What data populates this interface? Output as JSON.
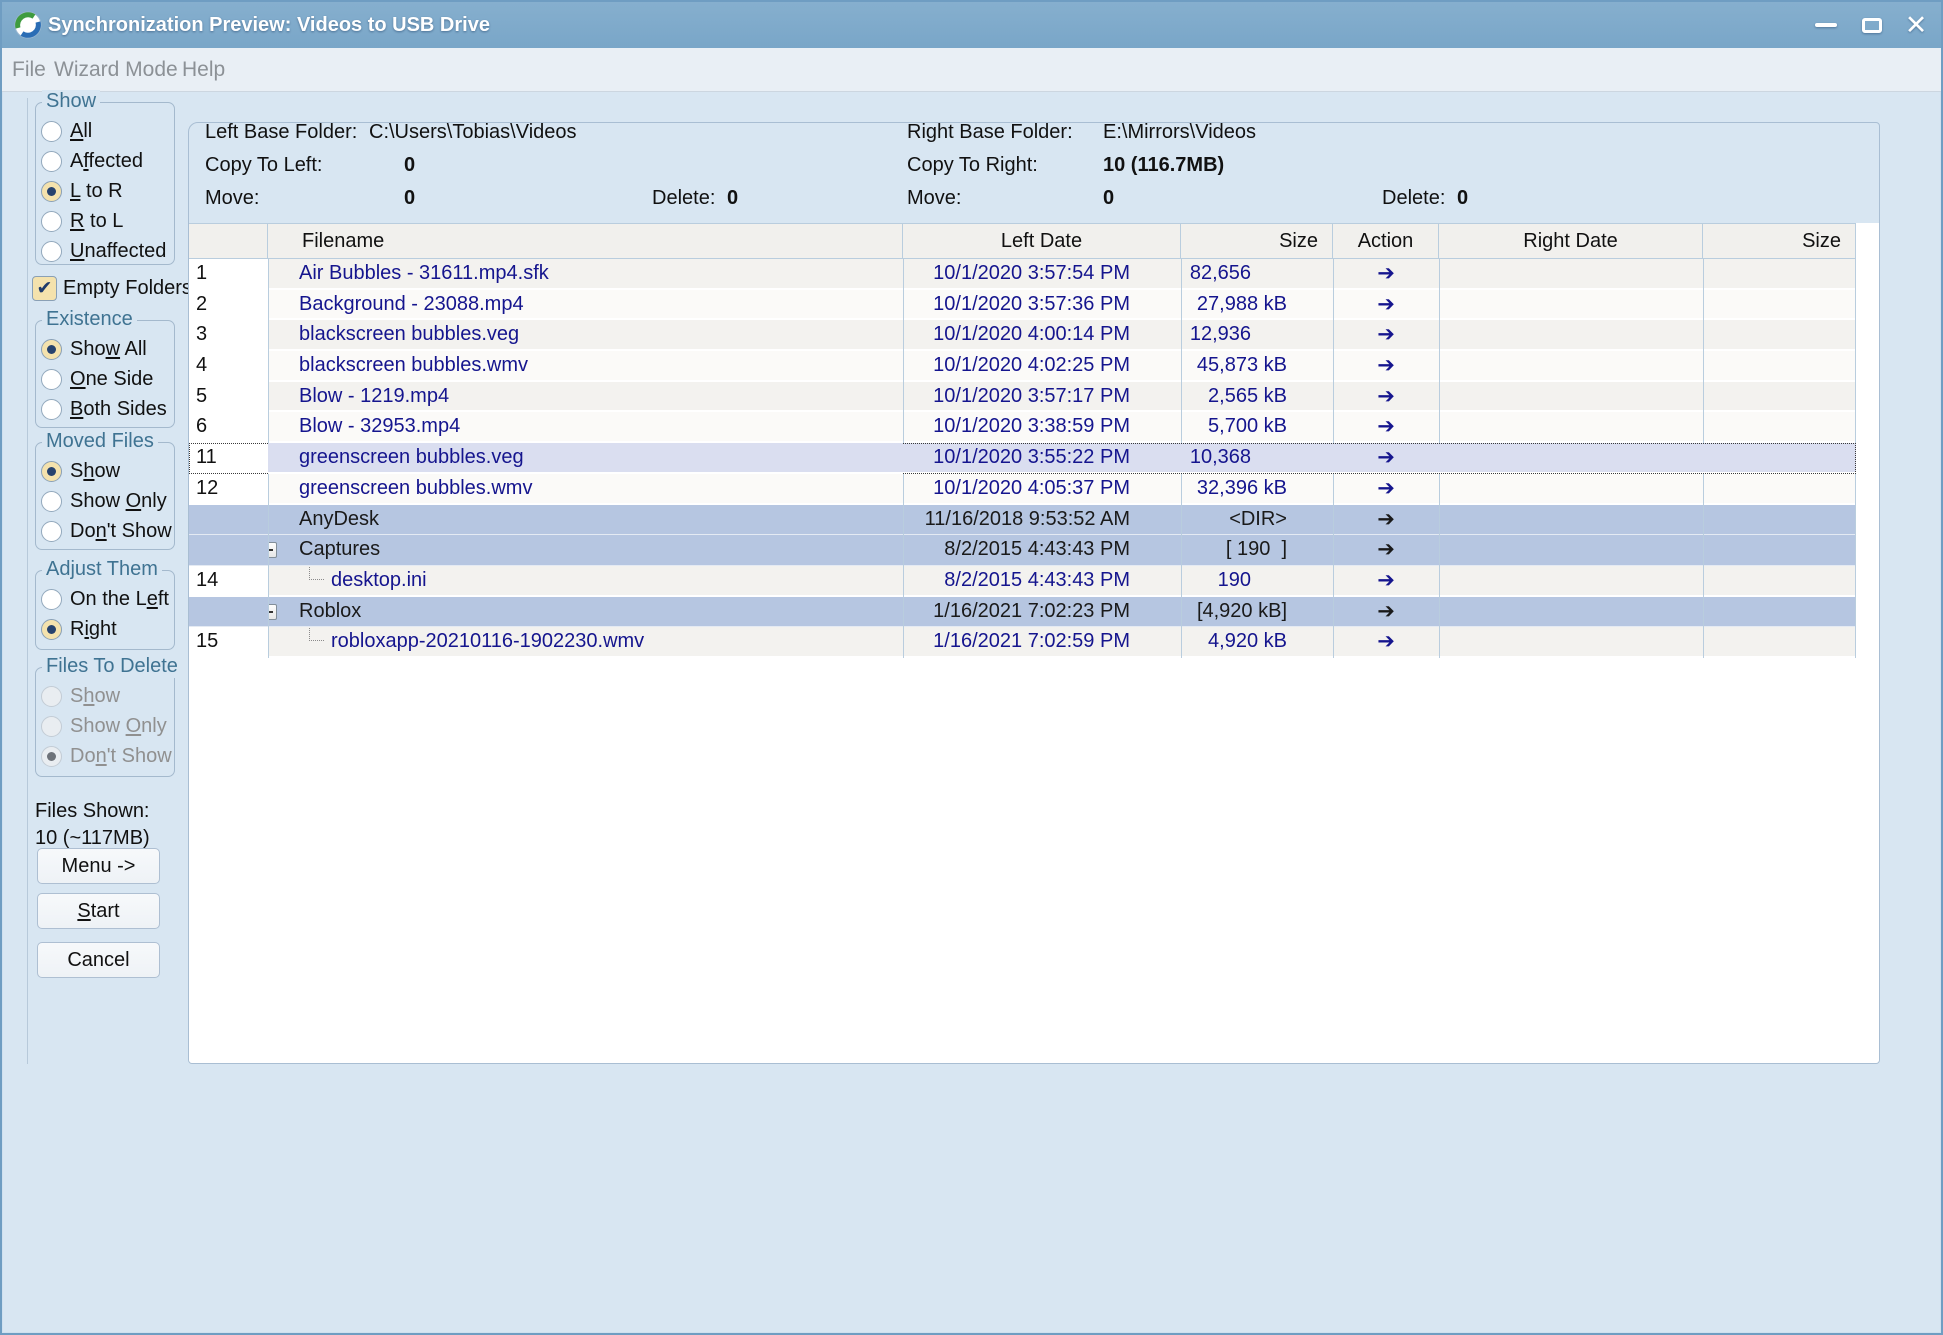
{
  "window": {
    "title": "Synchronization Preview: Videos to USB Drive",
    "controls": {
      "close_glyph": "✕"
    }
  },
  "menu": {
    "items": [
      "File",
      "Wizard Mode",
      "Help"
    ]
  },
  "sidebar": {
    "show_group": {
      "title": "Show",
      "options": [
        {
          "label": "&All",
          "selected": false
        },
        {
          "label": "A&ffected",
          "selected": false
        },
        {
          "label": "&L to R",
          "selected": true
        },
        {
          "label": "&R to L",
          "selected": false
        },
        {
          "label": "&Unaffected",
          "selected": false
        }
      ]
    },
    "empty_folders": {
      "label": "Empty Folders",
      "checked": true,
      "check_glyph": "✔"
    },
    "existence_group": {
      "title": "Existence",
      "options": [
        {
          "label": "Sho&w All",
          "selected": true
        },
        {
          "label": "&One Side",
          "selected": false
        },
        {
          "label": "&Both Sides",
          "selected": false
        }
      ]
    },
    "moved_group": {
      "title": "Moved Files",
      "options": [
        {
          "label": "S&how",
          "selected": true
        },
        {
          "label": "Show &Only",
          "selected": false
        },
        {
          "label": "Do&n't Show",
          "selected": false
        }
      ]
    },
    "adjust_group": {
      "title": "Adjust Them",
      "options": [
        {
          "label": "On the L&eft",
          "selected": false
        },
        {
          "label": "R&ight",
          "selected": true
        }
      ]
    },
    "delete_group": {
      "title": "Files To Delete",
      "disabled": true,
      "options": [
        {
          "label": "S&how",
          "selected": false
        },
        {
          "label": "Show &Only",
          "selected": false
        },
        {
          "label": "Do&n't Show",
          "selected": true
        }
      ]
    },
    "files_shown": {
      "label": "Files Shown:",
      "value": "10 (~117MB)"
    },
    "buttons": {
      "menu": "Menu ->",
      "start": "&Start",
      "cancel": "Cancel"
    }
  },
  "stats": {
    "left": {
      "base_label": "Left Base Folder:",
      "base_value": "C:\\Users\\Tobias\\Videos",
      "copy_label": "Copy To Left:",
      "copy_value": "0",
      "move_label": "Move:",
      "move_value": "0",
      "delete_label": "Delete:",
      "delete_value": "0"
    },
    "right": {
      "base_label": "Right Base Folder:",
      "base_value": "E:\\Mirrors\\Videos",
      "copy_label": "Copy To Right:",
      "copy_value": "10 (116.7MB)",
      "move_label": "Move:",
      "move_value": "0",
      "delete_label": "Delete:",
      "delete_value": "0"
    }
  },
  "table": {
    "headers": [
      "",
      "Filename",
      "Left Date",
      "Size",
      "Action",
      "Right Date",
      "Size"
    ],
    "rows": [
      {
        "num": "1",
        "name": "Air Bubbles - 31611.mp4.sfk",
        "left_date": "10/1/2020 3:57:54 PM",
        "size": "82,656",
        "action": "➔",
        "right_date": "",
        "right_size": "",
        "kind": "file"
      },
      {
        "num": "2",
        "name": "Background - 23088.mp4",
        "left_date": "10/1/2020 3:57:36 PM",
        "size": "27,988 kB",
        "action": "➔",
        "right_date": "",
        "right_size": "",
        "kind": "file"
      },
      {
        "num": "3",
        "name": "blackscreen bubbles.veg",
        "left_date": "10/1/2020 4:00:14 PM",
        "size": "12,936",
        "action": "➔",
        "right_date": "",
        "right_size": "",
        "kind": "file"
      },
      {
        "num": "4",
        "name": "blackscreen bubbles.wmv",
        "left_date": "10/1/2020 4:02:25 PM",
        "size": "45,873 kB",
        "action": "➔",
        "right_date": "",
        "right_size": "",
        "kind": "file"
      },
      {
        "num": "5",
        "name": "Blow - 1219.mp4",
        "left_date": "10/1/2020 3:57:17 PM",
        "size": "2,565 kB",
        "action": "➔",
        "right_date": "",
        "right_size": "",
        "kind": "file"
      },
      {
        "num": "6",
        "name": "Blow - 32953.mp4",
        "left_date": "10/1/2020 3:38:59 PM",
        "size": "5,700 kB",
        "action": "➔",
        "right_date": "",
        "right_size": "",
        "kind": "file"
      },
      {
        "num": "11",
        "name": "greenscreen bubbles.veg",
        "left_date": "10/1/2020 3:55:22 PM",
        "size": "10,368",
        "action": "➔",
        "right_date": "",
        "right_size": "",
        "kind": "file",
        "selected": true
      },
      {
        "num": "12",
        "name": "greenscreen bubbles.wmv",
        "left_date": "10/1/2020 4:05:37 PM",
        "size": "32,396 kB",
        "action": "➔",
        "right_date": "",
        "right_size": "",
        "kind": "file"
      },
      {
        "num": "",
        "name": "AnyDesk",
        "left_date": "11/16/2018 9:53:52 AM",
        "size": "<DIR>",
        "action": "➔",
        "right_date": "",
        "right_size": "",
        "kind": "folder"
      },
      {
        "num": "",
        "name": "Captures",
        "left_date": "8/2/2015 4:43:43 PM",
        "size": "[ 190  ]",
        "action": "➔",
        "right_date": "",
        "right_size": "",
        "kind": "folder",
        "expander": true
      },
      {
        "num": "14",
        "name": "desktop.ini",
        "left_date": "8/2/2015 4:43:43 PM",
        "size": "190",
        "action": "➔",
        "right_date": "",
        "right_size": "",
        "kind": "file",
        "child": true
      },
      {
        "num": "",
        "name": "Roblox",
        "left_date": "1/16/2021 7:02:23 PM",
        "size": "[4,920 kB]",
        "action": "➔",
        "right_date": "",
        "right_size": "",
        "kind": "folder",
        "expander": true
      },
      {
        "num": "15",
        "name": "robloxapp-20210116-1902230.wmv",
        "left_date": "1/16/2021 7:02:59 PM",
        "size": "4,920 kB",
        "action": "➔",
        "right_date": "",
        "right_size": "",
        "kind": "file",
        "child": true
      }
    ]
  }
}
